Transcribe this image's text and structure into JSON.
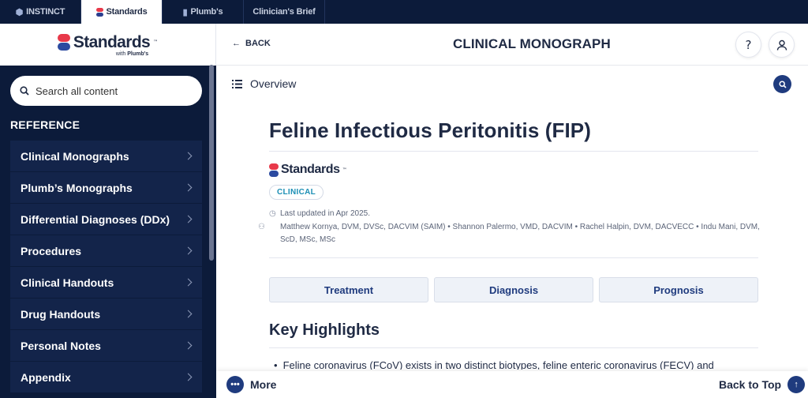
{
  "product_tabs": [
    {
      "label": "INSTINCT",
      "icon": "instinct-icon",
      "active": false
    },
    {
      "label": "Standards",
      "icon": "standards-logo-icon",
      "active": true
    },
    {
      "label": "Plumb's",
      "icon": "plumbs-logo-icon",
      "active": false
    },
    {
      "label": "Clinician's Brief",
      "icon": "",
      "active": false
    }
  ],
  "logo": {
    "word": "Standards",
    "tm": "™",
    "sub_prefix": "with",
    "sub_brand": "Plumb's"
  },
  "search": {
    "placeholder": "Search all content"
  },
  "sidebar": {
    "section_title": "REFERENCE",
    "items": [
      {
        "label": "Clinical Monographs"
      },
      {
        "label": "Plumb’s Monographs"
      },
      {
        "label": "Differential Diagnoses (DDx)"
      },
      {
        "label": "Procedures"
      },
      {
        "label": "Clinical Handouts"
      },
      {
        "label": "Drug Handouts"
      },
      {
        "label": "Personal Notes"
      },
      {
        "label": "Appendix"
      }
    ]
  },
  "header": {
    "back_label": "BACK",
    "title": "CLINICAL MONOGRAPH",
    "help_icon": "help-icon",
    "user_icon": "user-icon"
  },
  "overview": {
    "label": "Overview"
  },
  "monograph": {
    "title": "Feline Infectious Peritonitis (FIP)",
    "brand": "Standards",
    "badge": "CLINICAL",
    "updated": "Last updated in Apr 2025.",
    "authors": "Matthew Kornya, DVM, DVSc, DACVIM (SAIM)  • Shannon Palermo, VMD, DACVIM • Rachel Halpin, DVM, DACVECC • Indu Mani, DVM, ScD, MSc, MSc"
  },
  "section_tabs": [
    {
      "label": "Treatment"
    },
    {
      "label": "Diagnosis"
    },
    {
      "label": "Prognosis"
    }
  ],
  "key_highlights": {
    "title": "Key Highlights",
    "bullet_1": "Feline coronavirus (FCoV) exists in two distinct biotypes, feline enteric coronavirus (FECV) and"
  },
  "bottom": {
    "more_label": "More",
    "back_to_top_label": "Back to Top"
  },
  "colors": {
    "navy": "#0c1b3a",
    "accent_blue": "#1f3b7e",
    "brand_red": "#e8394a",
    "badge_teal": "#1c8fb5"
  }
}
